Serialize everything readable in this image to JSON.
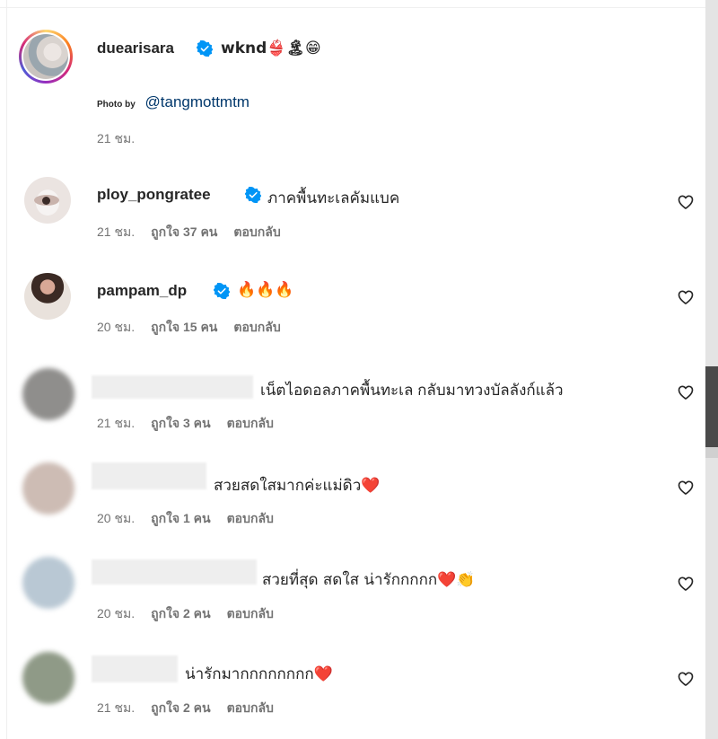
{
  "post": {
    "username": "duearisara",
    "caption": "wknd👙🏝😁",
    "photo_by_label": "Photo by",
    "photo_by_handle": "@tangmottmtm",
    "time": "21 ชม."
  },
  "comments": [
    {
      "username": "ploy_pongratee",
      "verified": true,
      "text": "ภาคพื้นทะเลคัมแบค",
      "time": "21 ชม.",
      "likes": "ถูกใจ 37 คน",
      "reply": "ตอบกลับ"
    },
    {
      "username": "pampam_dp",
      "verified": true,
      "text": "🔥🔥🔥",
      "time": "20 ชม.",
      "likes": "ถูกใจ 15 คน",
      "reply": "ตอบกลับ"
    },
    {
      "username": "",
      "verified": false,
      "text": "เน็ตไอดอลภาคพื้นทะเล กลับมาทวงบัลลังก์แล้ว",
      "time": "21 ชม.",
      "likes": "ถูกใจ 3 คน",
      "reply": "ตอบกลับ"
    },
    {
      "username": "",
      "verified": false,
      "text": "สวยสดใสมากค่ะแม่ดิว❤️",
      "time": "20 ชม.",
      "likes": "ถูกใจ 1 คน",
      "reply": "ตอบกลับ"
    },
    {
      "username": "",
      "verified": false,
      "text": "สวยที่สุด สดใส น่ารักกกกก❤️👏",
      "time": "20 ชม.",
      "likes": "ถูกใจ 2 คน",
      "reply": "ตอบกลับ"
    },
    {
      "username": "",
      "verified": false,
      "text": "น่ารักมากกกกกกกก❤️",
      "time": "21 ชม.",
      "likes": "ถูกใจ 2 คน",
      "reply": "ตอบกลับ"
    }
  ],
  "icons": {
    "verified": "verified-badge-icon",
    "like": "heart-outline-icon"
  },
  "colors": {
    "verified": "#0095f6",
    "meta": "#737373",
    "link": "#00376b"
  }
}
